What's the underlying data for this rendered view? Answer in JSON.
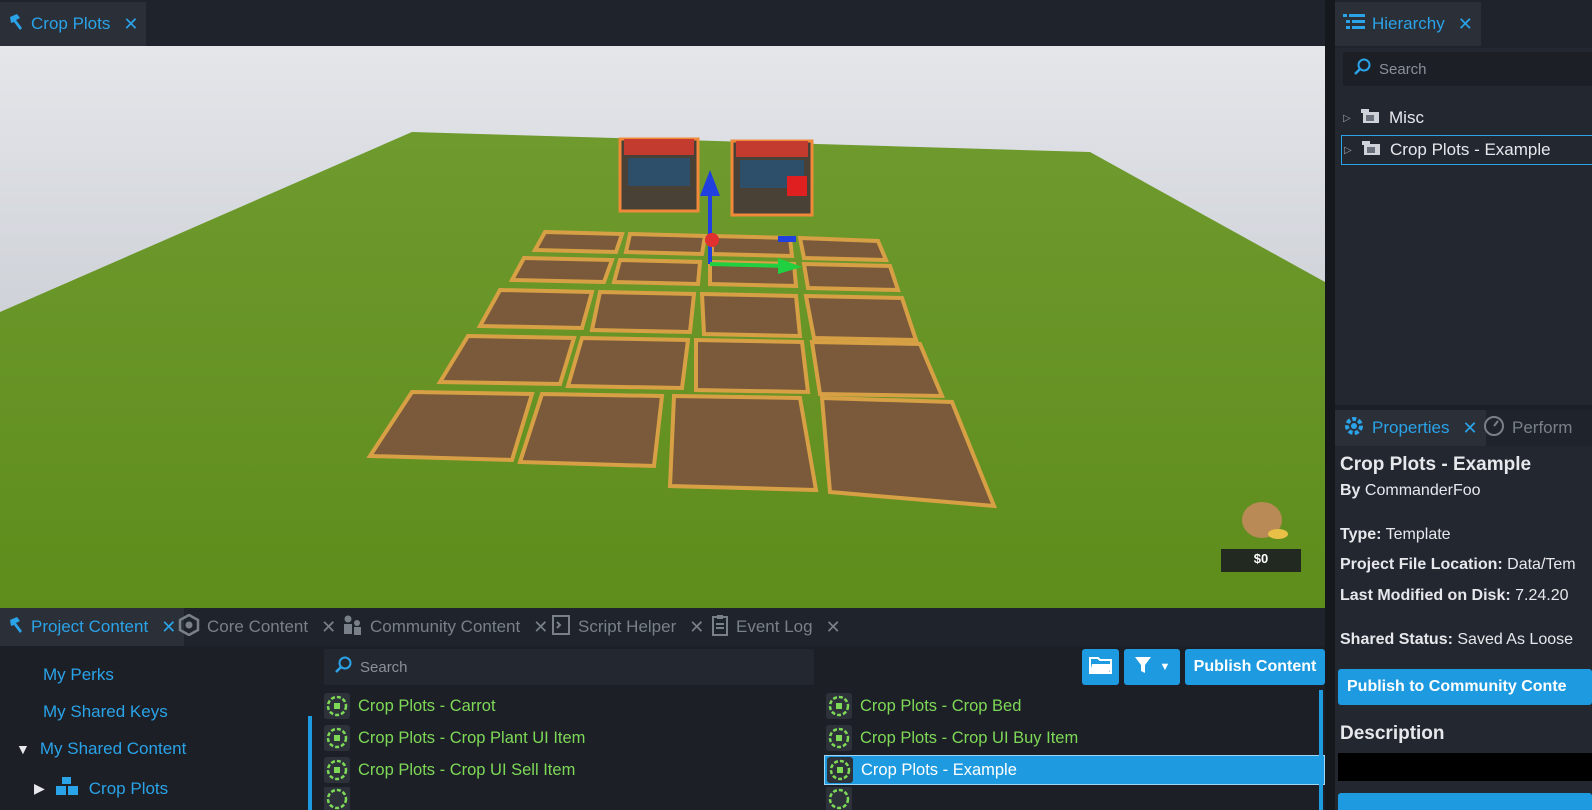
{
  "viewport_tab": {
    "label": "Crop Plots",
    "close": "✕"
  },
  "hud": {
    "money": "$0"
  },
  "hierarchy": {
    "tab_label": "Hierarchy",
    "close": "✕",
    "search_placeholder": "Search",
    "items": [
      {
        "label": "Misc"
      },
      {
        "label": "Crop Plots - Example"
      }
    ]
  },
  "properties": {
    "tab_label": "Properties",
    "close": "✕",
    "other_tab_label": "Perform",
    "title": "Crop Plots - Example",
    "by_label": "By",
    "author": "CommanderFoo",
    "type_label": "Type:",
    "type_value": "Template",
    "location_label": "Project File Location:",
    "location_value": "Data/Tem",
    "modified_label": "Last Modified on Disk:",
    "modified_value": "7.24.20",
    "shared_label": "Shared Status:",
    "shared_value": "Saved As Loose",
    "publish_community_label": "Publish to Community Conte",
    "description_label": "Description"
  },
  "bottom_tabs": [
    {
      "label": "Project Content"
    },
    {
      "label": "Core Content"
    },
    {
      "label": "Community Content"
    },
    {
      "label": "Script Helper"
    },
    {
      "label": "Event Log"
    }
  ],
  "close_glyph": "✕",
  "left_tree": {
    "items": [
      {
        "label": "My Perks"
      },
      {
        "label": "My Shared Keys"
      },
      {
        "label": "My Shared Content"
      },
      {
        "label": "Crop Plots"
      }
    ]
  },
  "content": {
    "search_placeholder": "Search",
    "publish_label": "Publish Content",
    "items_left": [
      {
        "label": "Crop Plots - Carrot"
      },
      {
        "label": "Crop Plots - Crop Plant UI Item"
      },
      {
        "label": "Crop Plots - Crop UI Sell Item"
      }
    ],
    "items_right": [
      {
        "label": "Crop Plots - Crop Bed"
      },
      {
        "label": "Crop Plots - Crop UI Buy Item"
      },
      {
        "label": "Crop Plots - Example"
      }
    ]
  },
  "colors": {
    "accent": "#1e9be0",
    "green_text": "#7ed957",
    "panel": "#232730"
  }
}
